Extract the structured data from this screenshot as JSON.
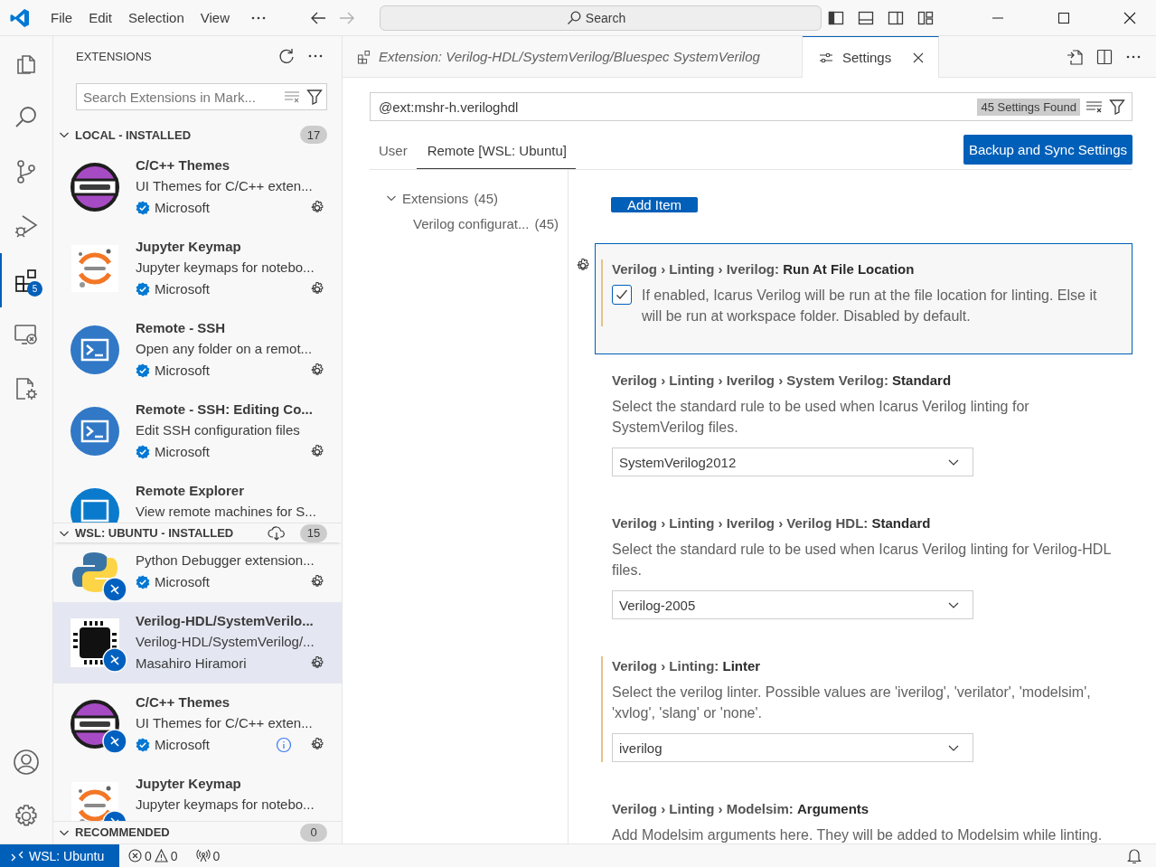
{
  "title_bar": {
    "menu": [
      "File",
      "Edit",
      "Selection",
      "View"
    ],
    "search": {
      "placeholder": "Search"
    }
  },
  "activity_bar": {
    "items": [
      {
        "kind": "explorer",
        "selected": false
      },
      {
        "kind": "search",
        "selected": false
      },
      {
        "kind": "source-control",
        "selected": false
      },
      {
        "kind": "run-debug",
        "selected": false
      },
      {
        "kind": "extensions",
        "selected": true,
        "badge": "5"
      },
      {
        "kind": "remote-explorer",
        "selected": false
      },
      {
        "kind": "settings-sync",
        "selected": false
      }
    ],
    "bottom": [
      {
        "kind": "account"
      },
      {
        "kind": "manage"
      }
    ]
  },
  "sidebar": {
    "title": "EXTENSIONS",
    "search": {
      "placeholder": "Search Extensions in Mark..."
    },
    "sections": [
      {
        "title": "LOCAL - INSTALLED",
        "expanded": true,
        "count": "17",
        "cloud_action": false,
        "items": [
          {
            "kind": "cpp",
            "title": "C/C++ Themes",
            "description": "UI Themes for C/C++ exten...",
            "publisher": "Microsoft",
            "verified": true,
            "remote": false,
            "info": false,
            "selected": false
          },
          {
            "kind": "jupyter",
            "title": "Jupyter Keymap",
            "description": "Jupyter keymaps for notebo...",
            "publisher": "Microsoft",
            "verified": true,
            "remote": false,
            "info": false,
            "selected": false
          },
          {
            "kind": "ssh",
            "title": "Remote - SSH",
            "description": "Open any folder on a remot...",
            "publisher": "Microsoft",
            "verified": true,
            "remote": false,
            "info": false,
            "selected": false
          },
          {
            "kind": "ssh",
            "title": "Remote - SSH: Editing Co...",
            "description": "Edit SSH configuration files",
            "publisher": "Microsoft",
            "verified": true,
            "remote": false,
            "info": false,
            "selected": false
          },
          {
            "kind": "monitor",
            "title": "Remote Explorer",
            "description": "View remote machines for S...",
            "verified": false,
            "remote": false,
            "info": false,
            "selected": false
          }
        ]
      },
      {
        "title": "WSL: UBUNTU - INSTALLED",
        "expanded": true,
        "count": "15",
        "cloud_action": true,
        "items": [
          {
            "kind": "python",
            "description": "Python Debugger extension...",
            "publisher": "Microsoft",
            "verified": true,
            "remote": true,
            "info": false,
            "selected": false
          },
          {
            "kind": "fpga",
            "title": "Verilog-HDL/SystemVerilo...",
            "description": "Verilog-HDL/SystemVerilog/...",
            "publisher": "Masahiro Hiramori",
            "verified": false,
            "remote": true,
            "info": false,
            "selected": true
          },
          {
            "kind": "cpp",
            "title": "C/C++ Themes",
            "description": "UI Themes for C/C++ exten...",
            "publisher": "Microsoft",
            "verified": true,
            "remote": true,
            "info": true,
            "selected": false
          },
          {
            "kind": "jupyter",
            "title": "Jupyter Keymap",
            "description": "Jupyter keymaps for notebo...",
            "verified": false,
            "remote": true,
            "info": false,
            "selected": false
          }
        ]
      },
      {
        "title": "RECOMMENDED",
        "expanded": true,
        "count": "0",
        "cloud_action": false
      }
    ]
  },
  "editor": {
    "tabs": [
      {
        "kind": "extension",
        "label": "Extension: Verilog-HDL/SystemVerilog/Bluespec SystemVerilog",
        "preview": true,
        "selected": false
      },
      {
        "kind": "settings",
        "label": "Settings",
        "preview": false,
        "selected": true
      }
    ],
    "settings": {
      "search": {
        "value": "@ext:mshr-h.veriloghdl"
      },
      "results": "45 Settings Found",
      "scopes": [
        {
          "label": "User",
          "selected": false
        },
        {
          "label": "Remote [WSL: Ubuntu]",
          "selected": true
        }
      ],
      "sync_button": "Backup and Sync Settings",
      "toc": [
        {
          "label": "Extensions",
          "count": "(45)",
          "expanded": true,
          "children": [
            {
              "label": "Verilog configurat...",
              "count": "(45)"
            }
          ]
        }
      ],
      "add_item_button": "Add Item",
      "items": [
        {
          "kind": "checkbox",
          "title": "Verilog › Linting › Iverilog: **Run At File Location**",
          "description": "If enabled, Icarus Verilog will be run at the file location for linting. Else it will be run at workspace folder. Disabled by default.",
          "checked": true,
          "modified": true,
          "focused": true
        },
        {
          "kind": "dropdown",
          "title": "Verilog › Linting › Iverilog › System Verilog: **Standard**",
          "description": "Select the standard rule to be used when Icarus Verilog linting for SystemVerilog files.",
          "value": "SystemVerilog2012",
          "modified": false,
          "focused": false
        },
        {
          "kind": "dropdown",
          "title": "Verilog › Linting › Iverilog › Verilog HDL: **Standard**",
          "description": "Select the standard rule to be used when Icarus Verilog linting for Verilog-HDL files.",
          "value": "Verilog-2005",
          "modified": false,
          "focused": false
        },
        {
          "kind": "dropdown",
          "title": "Verilog › Linting: **Linter**",
          "description": "Select the verilog linter. Possible values are 'iverilog', 'verilator', 'modelsim', 'xvlog', 'slang' or 'none'.",
          "value": "iverilog",
          "modified": true,
          "focused": false
        },
        {
          "kind": "text",
          "title": "Verilog › Linting › Modelsim: **Arguments**",
          "description": "Add Modelsim arguments here. They will be added to Modelsim while linting.",
          "modified": false,
          "focused": false
        }
      ]
    }
  },
  "status_bar": {
    "remote": "WSL: Ubuntu",
    "errors": "0",
    "warnings": "0",
    "ports": "0"
  }
}
